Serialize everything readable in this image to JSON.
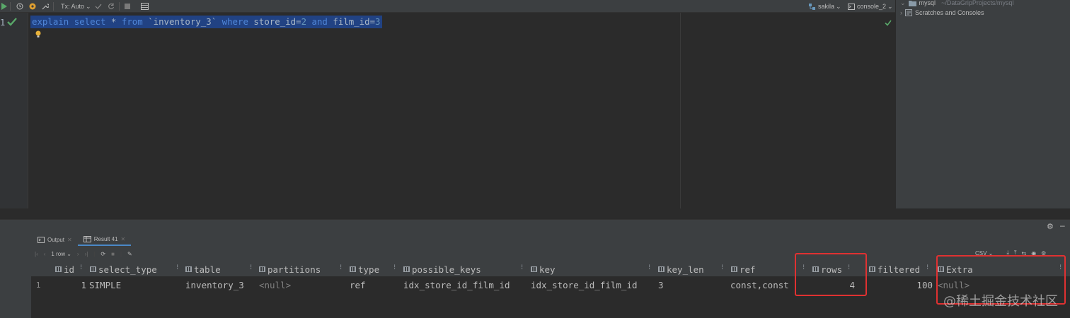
{
  "toolbar": {
    "tx_mode": "Tx: Auto",
    "schema": "sakila",
    "console": "console_2"
  },
  "project": {
    "root_name": "mysql",
    "root_path": "~/DataGripProjects/mysql",
    "scratches": "Scratches and Consoles"
  },
  "editor": {
    "line_number": "1",
    "tokens": {
      "explain": "explain",
      "select": "select",
      "star": "*",
      "from": "from",
      "table": "`inventory_3`",
      "where": "where",
      "col1": "store_id",
      "eq1": "=",
      "val1": "2",
      "and": "and",
      "col2": "film_id",
      "eq2": "=",
      "val2": "3"
    }
  },
  "bottom_tabs": [
    {
      "label": "Output"
    },
    {
      "label": "Result 41"
    }
  ],
  "results_toolbar": {
    "row_count": "1 row",
    "export_format": "CSV"
  },
  "columns": [
    "id",
    "select_type",
    "table",
    "partitions",
    "type",
    "possible_keys",
    "key",
    "key_len",
    "ref",
    "rows",
    "filtered",
    "Extra"
  ],
  "rows": [
    {
      "row_no": "1",
      "id": "1",
      "select_type": "SIMPLE",
      "table": "inventory_3",
      "partitions": "<null>",
      "type": "ref",
      "possible_keys": "idx_store_id_film_id",
      "key": "idx_store_id_film_id",
      "key_len": "3",
      "ref": "const,const",
      "rows": "4",
      "filtered": "100",
      "Extra": "<null>"
    }
  ],
  "watermark": "@稀土掘金技术社区",
  "colors": {
    "highlight_box": "#e03131",
    "selection": "#214283",
    "keyword": "#cc7832"
  }
}
